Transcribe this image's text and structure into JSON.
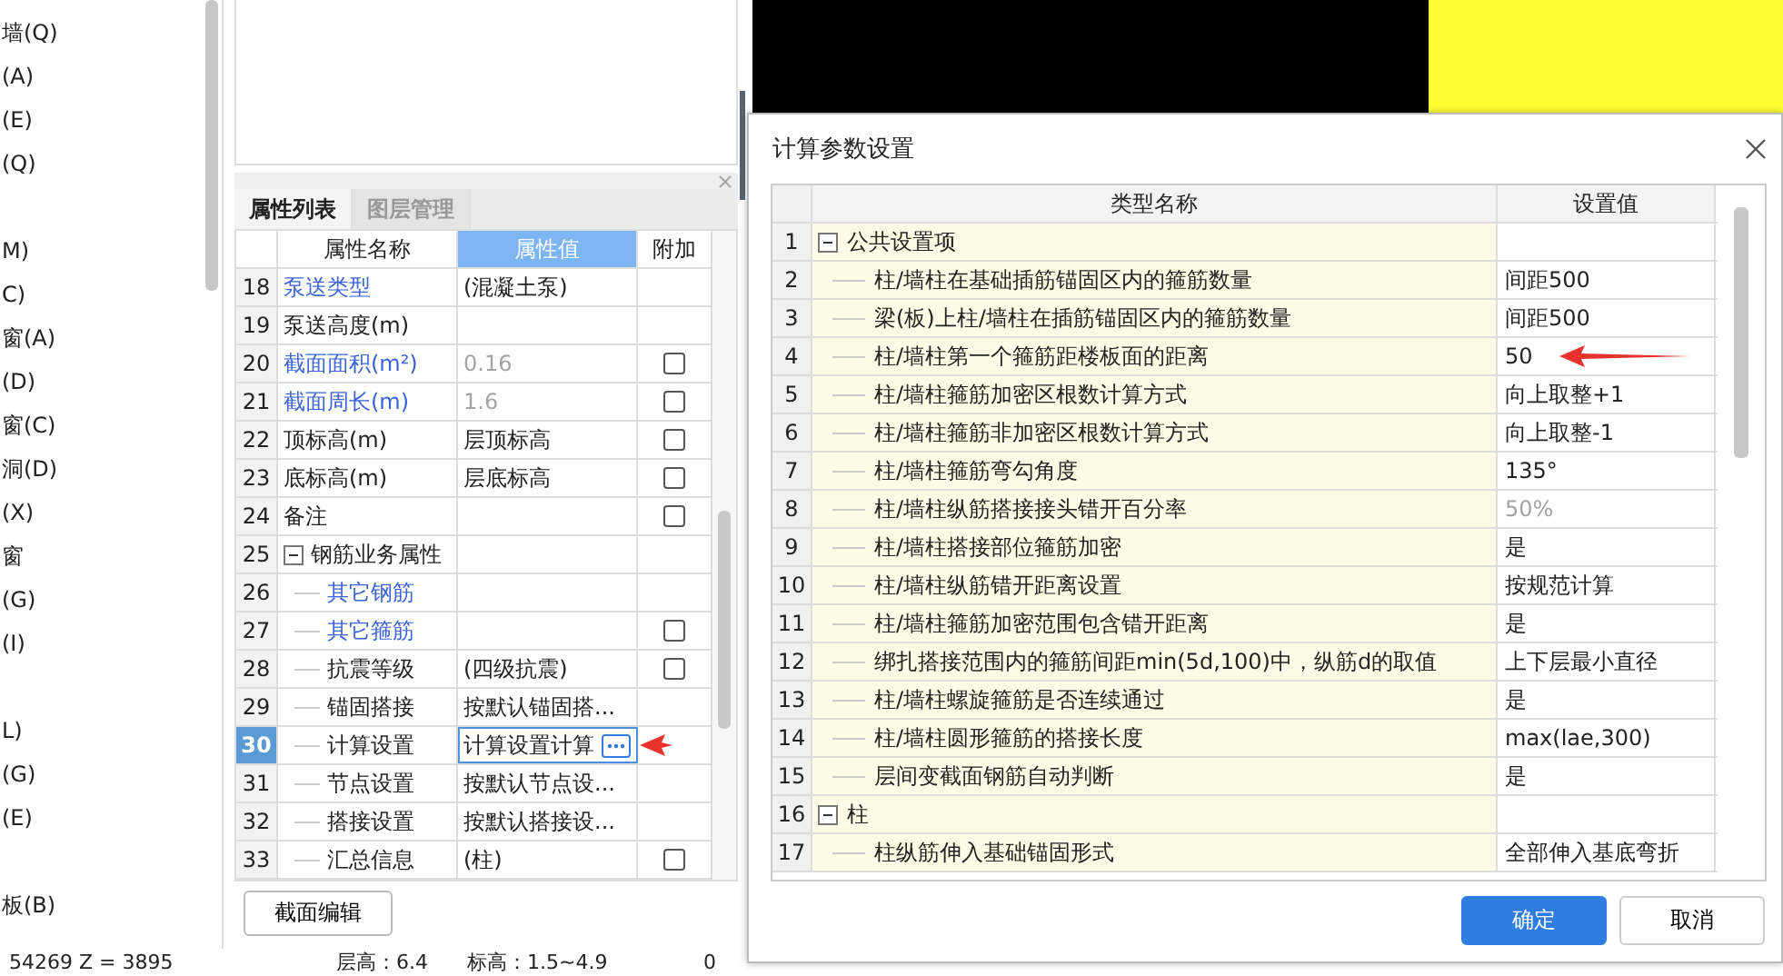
{
  "sidebar": {
    "groups": [
      {
        "items": [
          {
            "label": "墙(Q)"
          },
          {
            "label": "(A)"
          },
          {
            "label": "(E)"
          },
          {
            "label": "(Q)"
          }
        ]
      },
      {
        "items": [
          {
            "label": "M)"
          },
          {
            "label": "C)"
          },
          {
            "label": "窗(A)"
          },
          {
            "label": "(D)"
          },
          {
            "label": "窗(C)"
          },
          {
            "label": "洞(D)"
          },
          {
            "label": "(X)"
          },
          {
            "label": "窗"
          },
          {
            "label": "(G)"
          },
          {
            "label": "(I)"
          }
        ]
      },
      {
        "items": [
          {
            "label": "L)"
          },
          {
            "label": "(G)"
          },
          {
            "label": "(E)"
          }
        ]
      },
      {
        "items": [
          {
            "label": "板(B)"
          }
        ]
      }
    ]
  },
  "properties_panel": {
    "tabs": [
      {
        "label": "属性列表",
        "selected": true
      },
      {
        "label": "图层管理",
        "selected": false
      }
    ],
    "columns": [
      "属性名称",
      "属性值",
      "附加"
    ],
    "rows": [
      {
        "num": "18",
        "name": "泵送类型",
        "value": "(混凝土泵)",
        "link": true,
        "value_disabled": false,
        "selected": false
      },
      {
        "num": "19",
        "name": "泵送高度(m)",
        "link": false,
        "selected": false
      },
      {
        "num": "20",
        "name": "截面面积(m²)",
        "value": "0.16",
        "link": true,
        "value_disabled": true,
        "checked": false,
        "selected": false
      },
      {
        "num": "21",
        "name": "截面周长(m)",
        "value": "1.6",
        "link": true,
        "value_disabled": true,
        "checked": false,
        "selected": false
      },
      {
        "num": "22",
        "name": "顶标高(m)",
        "value": "层顶标高",
        "link": false,
        "value_disabled": false,
        "checked": false,
        "selected": false
      },
      {
        "num": "23",
        "name": "底标高(m)",
        "value": "层底标高",
        "link": false,
        "value_disabled": false,
        "checked": false,
        "selected": false
      },
      {
        "num": "24",
        "name": "备注",
        "link": false,
        "checked": false,
        "selected": false
      },
      {
        "num": "25",
        "name": "钢筋业务属性",
        "link": false,
        "selected": false,
        "expanded": true,
        "children": [
          {
            "num": "26",
            "name": "其它钢筋",
            "link": true,
            "selected": false
          },
          {
            "num": "27",
            "name": "其它箍筋",
            "link": true,
            "checked": false,
            "selected": false
          },
          {
            "num": "28",
            "name": "抗震等级",
            "value": "(四级抗震)",
            "link": false,
            "value_disabled": false,
            "checked": false,
            "selected": false
          },
          {
            "num": "29",
            "name": "锚固搭接",
            "value": "按默认锚固搭...",
            "link": false,
            "value_disabled": false,
            "selected": false
          },
          {
            "num": "30",
            "name": "计算设置",
            "value": "计算设置计算",
            "link": false,
            "value_disabled": false,
            "selected": true,
            "marked": true
          },
          {
            "num": "31",
            "name": "节点设置",
            "value": "按默认节点设...",
            "link": false,
            "value_disabled": false,
            "selected": false
          },
          {
            "num": "32",
            "name": "搭接设置",
            "value": "按默认搭接设...",
            "link": false,
            "value_disabled": false,
            "selected": false
          },
          {
            "num": "33",
            "name": "汇总信息",
            "value": "(柱)",
            "link": false,
            "value_disabled": false,
            "checked": false,
            "selected": false
          }
        ]
      }
    ],
    "edit_button": "截面编辑"
  },
  "dialog": {
    "title": "计算参数设置",
    "columns": [
      "类型名称",
      "设置值"
    ],
    "rows": [
      {
        "num": "1",
        "name": "公共设置项",
        "expanded": true,
        "children": [
          {
            "num": "2",
            "name": "柱/墙柱在基础插筋锚固区内的箍筋数量",
            "value": "间距500",
            "value_disabled": false
          },
          {
            "num": "3",
            "name": "梁(板)上柱/墙柱在插筋锚固区内的箍筋数量",
            "value": "间距500",
            "value_disabled": false
          },
          {
            "num": "4",
            "name": "柱/墙柱第一个箍筋距楼板面的距离",
            "value": "50",
            "value_disabled": false,
            "marked": true
          },
          {
            "num": "5",
            "name": "柱/墙柱箍筋加密区根数计算方式",
            "value": "向上取整+1",
            "value_disabled": false
          },
          {
            "num": "6",
            "name": "柱/墙柱箍筋非加密区根数计算方式",
            "value": "向上取整-1",
            "value_disabled": false
          },
          {
            "num": "7",
            "name": "柱/墙柱箍筋弯勾角度",
            "value": "135°",
            "value_disabled": false
          },
          {
            "num": "8",
            "name": "柱/墙柱纵筋搭接接头错开百分率",
            "value": "50%",
            "value_disabled": true
          },
          {
            "num": "9",
            "name": "柱/墙柱搭接部位箍筋加密",
            "value": "是",
            "value_disabled": false
          },
          {
            "num": "10",
            "name": "柱/墙柱纵筋错开距离设置",
            "value": "按规范计算",
            "value_disabled": false
          },
          {
            "num": "11",
            "name": "柱/墙柱箍筋加密范围包含错开距离",
            "value": "是",
            "value_disabled": false
          },
          {
            "num": "12",
            "name": "绑扎搭接范围内的箍筋间距min(5d,100)中，纵筋d的取值",
            "value": "上下层最小直径",
            "value_disabled": false
          },
          {
            "num": "13",
            "name": "柱/墙柱螺旋箍筋是否连续通过",
            "value": "是",
            "value_disabled": false
          },
          {
            "num": "14",
            "name": "柱/墙柱圆形箍筋的搭接长度",
            "value": "max(lae,300)",
            "value_disabled": false
          },
          {
            "num": "15",
            "name": "层间变截面钢筋自动判断",
            "value": "是",
            "value_disabled": false
          }
        ]
      },
      {
        "num": "16",
        "name": "柱",
        "expanded": true,
        "children": [
          {
            "num": "17",
            "name": "柱纵筋伸入基础锚固形式",
            "value": "全部伸入基底弯折",
            "value_disabled": false
          }
        ]
      }
    ],
    "buttons": [
      {
        "label": "确定",
        "kind": "primary"
      },
      {
        "label": "取消",
        "kind": "secondary"
      }
    ]
  },
  "status_bar": {
    "coordinates": "54269 Z = 3895",
    "floor_height": "层高：6.4",
    "elevation": "标高：1.5~4.9",
    "count": "0"
  }
}
